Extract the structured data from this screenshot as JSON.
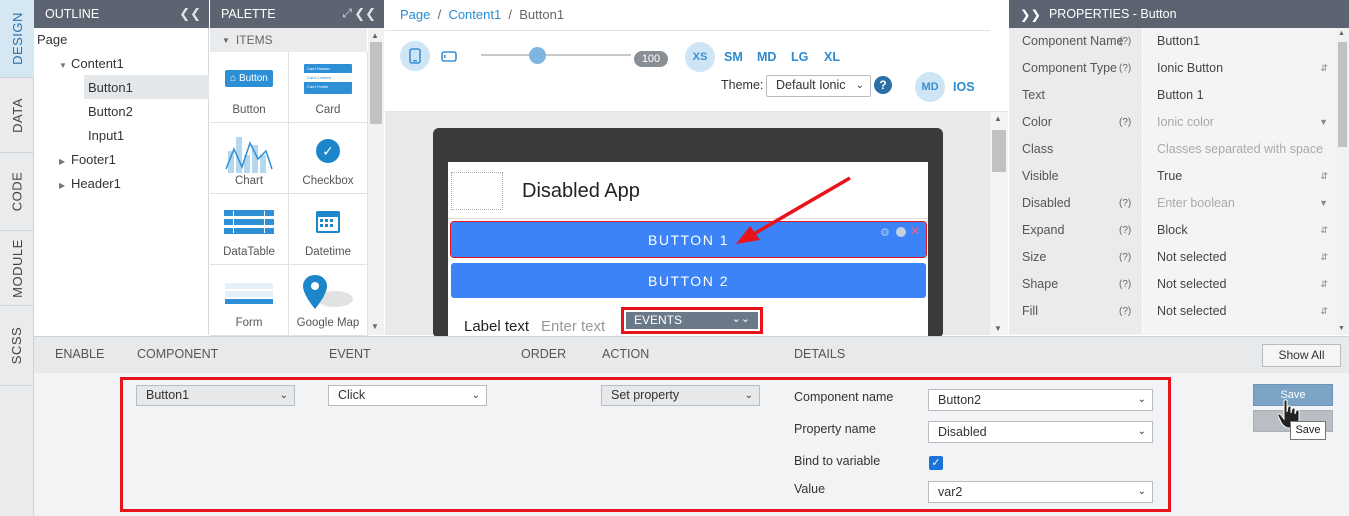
{
  "vtabs": [
    "DESIGN",
    "DATA",
    "CODE",
    "MODULE",
    "SCSS"
  ],
  "outline": {
    "title": "OUTLINE",
    "items": {
      "page": "Page",
      "content1": "Content1",
      "button1": "Button1",
      "button2": "Button2",
      "input1": "Input1",
      "footer1": "Footer1",
      "header1": "Header1"
    }
  },
  "palette": {
    "title": "PALETTE",
    "section": "ITEMS",
    "items": [
      "Button",
      "Card",
      "Chart",
      "Checkbox",
      "DataTable",
      "Datetime",
      "Form",
      "Google Map"
    ],
    "button_icon_text": "Button",
    "card_icon_lines": [
      "Card Header",
      "Card Content",
      "Card Footer"
    ]
  },
  "center": {
    "breadcrumb": [
      "Page",
      "Content1",
      "Button1"
    ],
    "slider_value": "100",
    "sizes": [
      "XS",
      "SM",
      "MD",
      "LG",
      "XL"
    ],
    "theme_label": "Theme:",
    "theme_value": "Default Ionic",
    "modes": [
      "MD",
      "IOS"
    ],
    "app_title": "Disabled App",
    "button1": "BUTTON 1",
    "button2": "BUTTON 2",
    "label_text": "Label text",
    "input_placeholder": "Enter text",
    "events_dropdown": "EVENTS"
  },
  "properties": {
    "title": "PROPERTIES - Button",
    "rows": [
      {
        "name": "Component Name",
        "help": "(?)",
        "value": "Button1",
        "placeholder": false,
        "arrow": ""
      },
      {
        "name": "Component Type",
        "help": "(?)",
        "value": "Ionic Button",
        "placeholder": false,
        "arrow": "updown"
      },
      {
        "name": "Text",
        "help": "",
        "value": "Button 1",
        "placeholder": false,
        "arrow": ""
      },
      {
        "name": "Color",
        "help": "(?)",
        "value": "Ionic color",
        "placeholder": true,
        "arrow": "down"
      },
      {
        "name": "Class",
        "help": "",
        "value": "Classes separated with space",
        "placeholder": true,
        "arrow": ""
      },
      {
        "name": "Visible",
        "help": "",
        "value": "True",
        "placeholder": false,
        "arrow": "updown"
      },
      {
        "name": "Disabled",
        "help": "(?)",
        "value": "Enter boolean",
        "placeholder": true,
        "arrow": "down"
      },
      {
        "name": "Expand",
        "help": "(?)",
        "value": "Block",
        "placeholder": false,
        "arrow": "updown"
      },
      {
        "name": "Size",
        "help": "(?)",
        "value": "Not selected",
        "placeholder": false,
        "arrow": "updown"
      },
      {
        "name": "Shape",
        "help": "(?)",
        "value": "Not selected",
        "placeholder": false,
        "arrow": "updown"
      },
      {
        "name": "Fill",
        "help": "(?)",
        "value": "Not selected",
        "placeholder": false,
        "arrow": "updown"
      }
    ]
  },
  "events": {
    "columns": [
      "ENABLE",
      "COMPONENT",
      "EVENT",
      "ORDER",
      "ACTION",
      "DETAILS"
    ],
    "show_all": "Show All",
    "component": "Button1",
    "event": "Click",
    "action": "Set property",
    "details": {
      "component_name_label": "Component name",
      "component_name_value": "Button2",
      "property_name_label": "Property name",
      "property_name_value": "Disabled",
      "bind_label": "Bind to variable",
      "bind_checked": true,
      "value_label": "Value",
      "value_value": "var2"
    },
    "save": "Save",
    "tooltip": "Save"
  },
  "colors": {
    "accent": "#2a8bd0",
    "header_bg": "#5b6470",
    "ionic_blue": "#3b83f6",
    "highlight_red": "#e8131b"
  }
}
